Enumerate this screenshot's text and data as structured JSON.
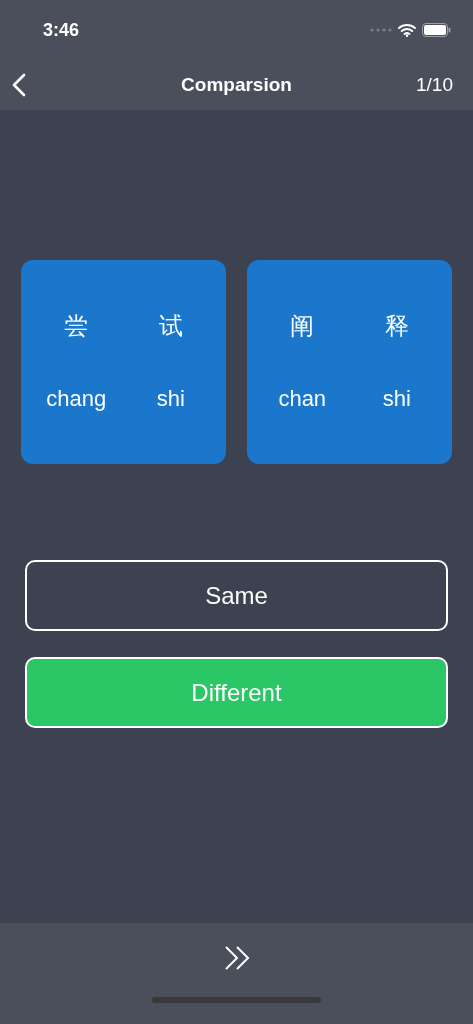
{
  "status_bar": {
    "time": "3:46"
  },
  "nav": {
    "title": "Comparsion",
    "progress": "1/10"
  },
  "cards": [
    {
      "syllables": [
        {
          "hanzi": "尝",
          "pinyin": "chang"
        },
        {
          "hanzi": "试",
          "pinyin": "shi"
        }
      ]
    },
    {
      "syllables": [
        {
          "hanzi": "阐",
          "pinyin": "chan"
        },
        {
          "hanzi": "释",
          "pinyin": "shi"
        }
      ]
    }
  ],
  "options": [
    {
      "label": "Same",
      "selected": false
    },
    {
      "label": "Different",
      "selected": true
    }
  ]
}
